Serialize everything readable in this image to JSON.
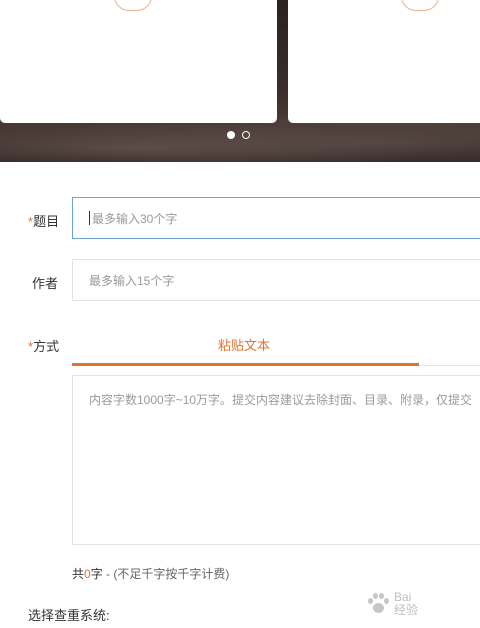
{
  "form": {
    "title": {
      "label": "题目",
      "required_mark": "*",
      "placeholder": "最多输入30个字"
    },
    "author": {
      "label": "作者",
      "placeholder": "最多输入15个字"
    },
    "method": {
      "label": "方式",
      "required_mark": "*",
      "active_tab": "粘贴文本"
    },
    "content": {
      "placeholder": "内容字数1000字~10万字。提交内容建议去除封面、目录、附录，仅提交"
    },
    "count": {
      "prefix": "共",
      "value": "0",
      "suffix": "字",
      "separator": " - ",
      "note": "(不足千字按千字计费)"
    },
    "system_label": "选择查重系统:"
  },
  "carousel": {
    "slides": 2,
    "active_index": 0
  },
  "watermark": {
    "text_line1": "Bai",
    "text_line2": "经验"
  },
  "colors": {
    "accent": "#e0742c",
    "focus_border": "#6aa4d6",
    "placeholder": "#9a9a9a"
  }
}
